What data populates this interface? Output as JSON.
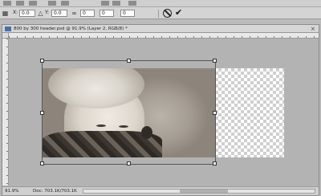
{
  "options": {
    "x_label": "X:",
    "x_value": "0.0",
    "y_label": "Y:",
    "y_value": "0.0",
    "w_value": "0",
    "h_value": "0",
    "angle_value": "0"
  },
  "document": {
    "title": "800 by 300 header.psd @ 91.9% (Layer 2, RGB/8) *",
    "close": "×"
  },
  "status": {
    "zoom": "91.9%",
    "doc_size": "Doc: 703.1K/703.1K"
  },
  "icons": {
    "cancel": "cancel-transform-icon",
    "commit": "commit-transform-icon",
    "commit_glyph": "✔"
  }
}
